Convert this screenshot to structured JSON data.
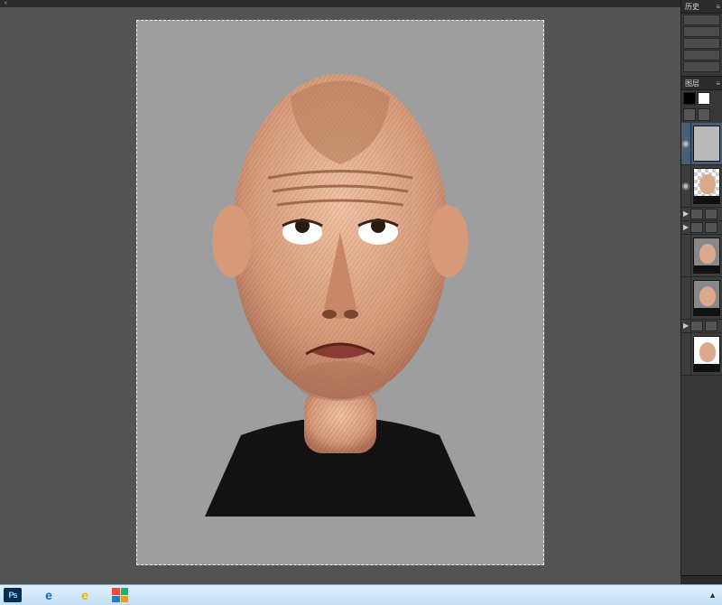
{
  "tab": {
    "close_glyph": "×"
  },
  "panels": {
    "history_label": "历史",
    "history_menu_glyph": "≡",
    "layers_label": "图层",
    "layers_menu_glyph": "≡"
  },
  "layers": {
    "visible_glyph": "◉",
    "fold_glyph": "▶",
    "items": [
      {
        "kind": "thumb-gray",
        "selected": true,
        "visible": true
      },
      {
        "kind": "thumb-face-checker",
        "visible": true
      },
      {
        "kind": "folder"
      },
      {
        "kind": "folder"
      },
      {
        "kind": "thumb-face"
      },
      {
        "kind": "thumb-face"
      },
      {
        "kind": "folder"
      },
      {
        "kind": "thumb-face-white"
      }
    ]
  },
  "taskbar": {
    "ps_label": "Ps",
    "ie_glyph": "e",
    "tray_arrow": "▲"
  }
}
